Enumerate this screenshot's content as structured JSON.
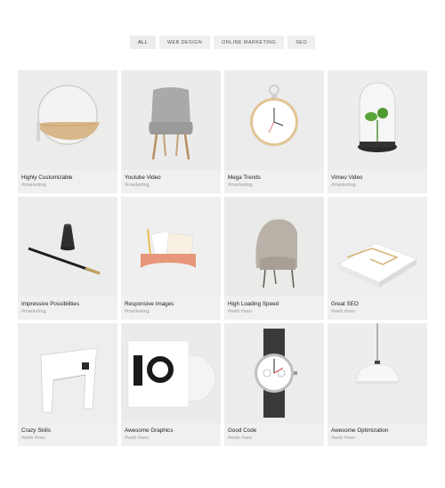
{
  "filters": [
    {
      "label": "ALL",
      "active": true
    },
    {
      "label": "WEB DESIGN"
    },
    {
      "label": "ONLINE MARKETING"
    },
    {
      "label": "SEO"
    }
  ],
  "items": [
    {
      "title": "Highly Customizable",
      "tags": "#marketing",
      "image": "round-mirror-shelf"
    },
    {
      "title": "Youtube Video",
      "tags": "#marketing",
      "image": "grey-chair"
    },
    {
      "title": "Mega Trends",
      "tags": "#marketing",
      "image": "pocket-watch"
    },
    {
      "title": "Vimeo Video",
      "tags": "#marketing",
      "image": "glass-terrarium"
    },
    {
      "title": "Impressive Possibilities",
      "tags": "#marketing",
      "image": "fountain-pen"
    },
    {
      "title": "Responsive Images",
      "tags": "#marketing",
      "image": "letter-holder"
    },
    {
      "title": "High Loading Speed",
      "tags": "#web #seo",
      "image": "lounge-chair"
    },
    {
      "title": "Great SEO",
      "tags": "#web #seo",
      "image": "paper-box"
    },
    {
      "title": "Crazy Skills",
      "tags": "#web #seo",
      "image": "white-stool"
    },
    {
      "title": "Awesome Graphics",
      "tags": "#web #seo",
      "image": "record-cover"
    },
    {
      "title": "Good Code",
      "tags": "#web #seo",
      "image": "wrist-watch"
    },
    {
      "title": "Awesome Optimization",
      "tags": "#web #seo",
      "image": "pendant-lamp"
    }
  ]
}
